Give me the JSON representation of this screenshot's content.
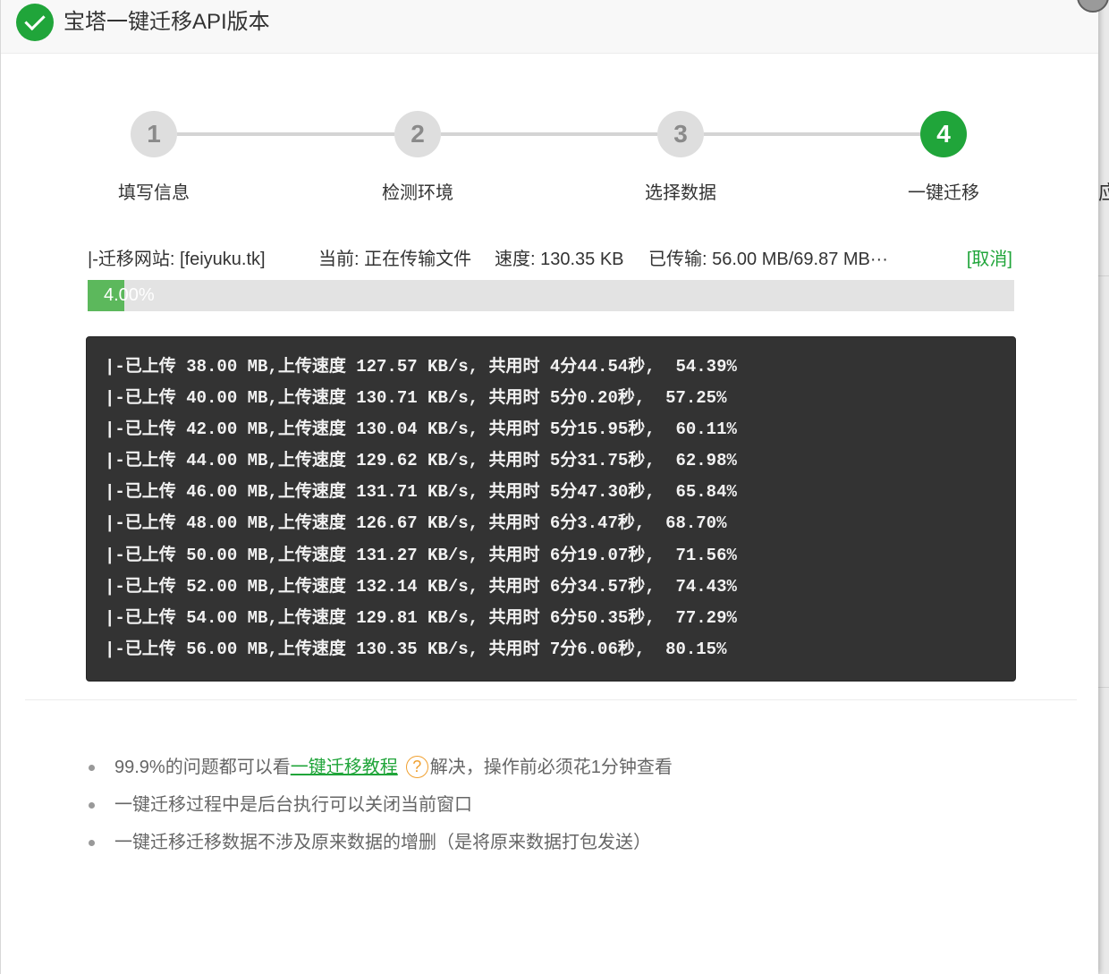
{
  "dialog": {
    "title": "宝塔一键迁移API版本",
    "title_icon": "check-circle-icon",
    "close_icon": "close-icon"
  },
  "colors": {
    "accent": "#20a53a",
    "progress_fill": "#5cb85c",
    "log_background": "#333333",
    "help_icon": "#f0a030"
  },
  "steps": {
    "active": 4,
    "items": [
      {
        "number": "1",
        "label": "填写信息"
      },
      {
        "number": "2",
        "label": "检测环境"
      },
      {
        "number": "3",
        "label": "选择数据"
      },
      {
        "number": "4",
        "label": "一键迁移"
      }
    ]
  },
  "status": {
    "site": "|-迁移网站: [feiyuku.tk]",
    "current": "当前: 正在传输文件",
    "speed": "速度: 130.35 KB",
    "transferred": "已传输: 56.00 MB/69.87 MB···",
    "cancel_label": "[取消]"
  },
  "progress": {
    "percent": 4.0,
    "label": "4.00%"
  },
  "log": {
    "lines": [
      "|-已上传 38.00 MB,上传速度 127.57 KB/s, 共用时 4分44.54秒,  54.39%",
      "|-已上传 40.00 MB,上传速度 130.71 KB/s, 共用时 5分0.20秒,  57.25%",
      "|-已上传 42.00 MB,上传速度 130.04 KB/s, 共用时 5分15.95秒,  60.11%",
      "|-已上传 44.00 MB,上传速度 129.62 KB/s, 共用时 5分31.75秒,  62.98%",
      "|-已上传 46.00 MB,上传速度 131.71 KB/s, 共用时 5分47.30秒,  65.84%",
      "|-已上传 48.00 MB,上传速度 126.67 KB/s, 共用时 6分3.47秒,  68.70%",
      "|-已上传 50.00 MB,上传速度 131.27 KB/s, 共用时 6分19.07秒,  71.56%",
      "|-已上传 52.00 MB,上传速度 132.14 KB/s, 共用时 6分34.57秒,  74.43%",
      "|-已上传 54.00 MB,上传速度 129.81 KB/s, 共用时 6分50.35秒,  77.29%",
      "|-已上传 56.00 MB,上传速度 130.35 KB/s, 共用时 7分6.06秒,  80.15%"
    ]
  },
  "tips": {
    "first": {
      "before": "99.9%的问题都可以看",
      "link": "一键迁移教程",
      "help_glyph": "?",
      "after": "解决，操作前必须花1分钟查看"
    },
    "second": "一键迁移过程中是后台执行可以关闭当前窗口",
    "third": "一键迁移迁移数据不涉及原来数据的增删（是将原来数据打包发送）"
  },
  "background_page": {
    "partial_text": "应"
  }
}
